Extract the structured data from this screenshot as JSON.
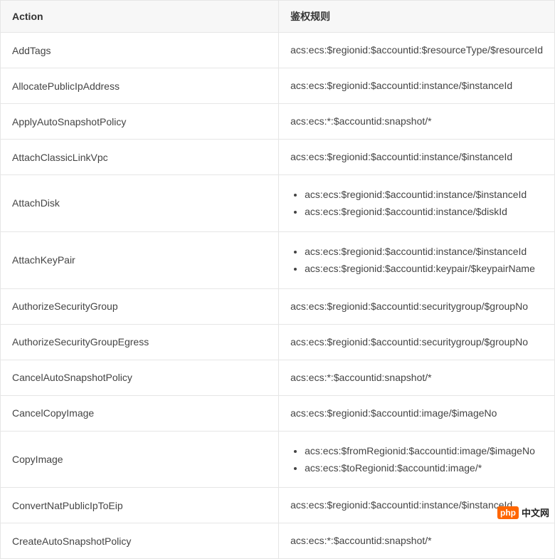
{
  "table": {
    "headers": {
      "action": "Action",
      "rule": "鉴权规则"
    },
    "rows": [
      {
        "action": "AddTags",
        "multi": false,
        "rules": [
          "acs:ecs:$regionid:$accountid:$resourceType/$resourceId"
        ]
      },
      {
        "action": "AllocatePublicIpAddress",
        "multi": false,
        "rules": [
          "acs:ecs:$regionid:$accountid:instance/$instanceId"
        ]
      },
      {
        "action": "ApplyAutoSnapshotPolicy",
        "multi": false,
        "rules": [
          "acs:ecs:*:$accountid:snapshot/*"
        ]
      },
      {
        "action": "AttachClassicLinkVpc",
        "multi": false,
        "rules": [
          "acs:ecs:$regionid:$accountid:instance/$instanceId"
        ]
      },
      {
        "action": "AttachDisk",
        "multi": true,
        "rules": [
          "acs:ecs:$regionid:$accountid:instance/$instanceId",
          "acs:ecs:$regionid:$accountid:instance/$diskId"
        ]
      },
      {
        "action": "AttachKeyPair",
        "multi": true,
        "rules": [
          "acs:ecs:$regionid:$accountid:instance/$instanceId",
          "acs:ecs:$regionid:$accountid:keypair/$keypairName"
        ]
      },
      {
        "action": "AuthorizeSecurityGroup",
        "multi": false,
        "rules": [
          "acs:ecs:$regionid:$accountid:securitygroup/$groupNo"
        ]
      },
      {
        "action": "AuthorizeSecurityGroupEgress",
        "multi": false,
        "rules": [
          "acs:ecs:$regionid:$accountid:securitygroup/$groupNo"
        ]
      },
      {
        "action": "CancelAutoSnapshotPolicy",
        "multi": false,
        "rules": [
          "acs:ecs:*:$accountid:snapshot/*"
        ]
      },
      {
        "action": "CancelCopyImage",
        "multi": false,
        "rules": [
          "acs:ecs:$regionid:$accountid:image/$imageNo"
        ]
      },
      {
        "action": "CopyImage",
        "multi": true,
        "rules": [
          "acs:ecs:$fromRegionid:$accountid:image/$imageNo",
          "acs:ecs:$toRegionid:$accountid:image/*"
        ]
      },
      {
        "action": "ConvertNatPublicIpToEip",
        "multi": false,
        "rules": [
          "acs:ecs:$regionid:$accountid:instance/$instanceId"
        ]
      },
      {
        "action": "CreateAutoSnapshotPolicy",
        "multi": false,
        "rules": [
          "acs:ecs:*:$accountid:snapshot/*"
        ]
      }
    ]
  },
  "logo": {
    "badge": "php",
    "text": "中文网"
  }
}
